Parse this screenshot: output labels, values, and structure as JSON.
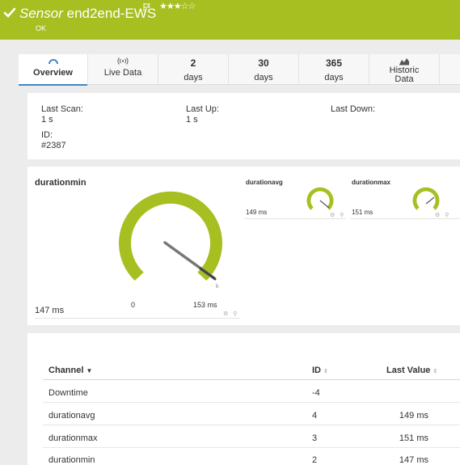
{
  "header": {
    "title_prefix": "Sensor",
    "title_name": "end2end-EWS",
    "stars": "★★★☆☆",
    "status": "OK"
  },
  "tabs": [
    {
      "icon": "gauge-icon",
      "label": "Overview"
    },
    {
      "icon": "live-data-icon",
      "label": "Live Data"
    },
    {
      "big": "2",
      "label": "days"
    },
    {
      "big": "30",
      "label": "days"
    },
    {
      "big": "365",
      "label": "days"
    },
    {
      "icon": "historic-data-icon",
      "label": "Historic Data",
      "label_line1": "Historic",
      "label_line2": "Data"
    }
  ],
  "info": {
    "last_scan_label": "Last Scan:",
    "last_scan_value": "1 s",
    "last_up_label": "Last Up:",
    "last_up_value": "1 s",
    "last_down_label": "Last Down:",
    "id_label": "ID:",
    "id_value": "#2387"
  },
  "gauges": {
    "main": {
      "name": "durationmin",
      "value": "147 ms",
      "min_label": "0",
      "max_label": "153 ms",
      "unit_mark": "k"
    },
    "avg": {
      "name": "durationavg",
      "value": "149 ms"
    },
    "max": {
      "name": "durationmax",
      "value": "151 ms"
    }
  },
  "table": {
    "headers": {
      "channel": "Channel",
      "id": "ID",
      "last_value": "Last Value"
    },
    "rows": [
      {
        "channel": "Downtime",
        "id": "-4",
        "value": ""
      },
      {
        "channel": "durationavg",
        "id": "4",
        "value": "149 ms"
      },
      {
        "channel": "durationmax",
        "id": "3",
        "value": "151 ms"
      },
      {
        "channel": "durationmin",
        "id": "2",
        "value": "147 ms"
      }
    ]
  },
  "colors": {
    "brand_green": "#a7bf21",
    "tab_accent": "#3f88c5",
    "gauge_needle": "#777777"
  }
}
